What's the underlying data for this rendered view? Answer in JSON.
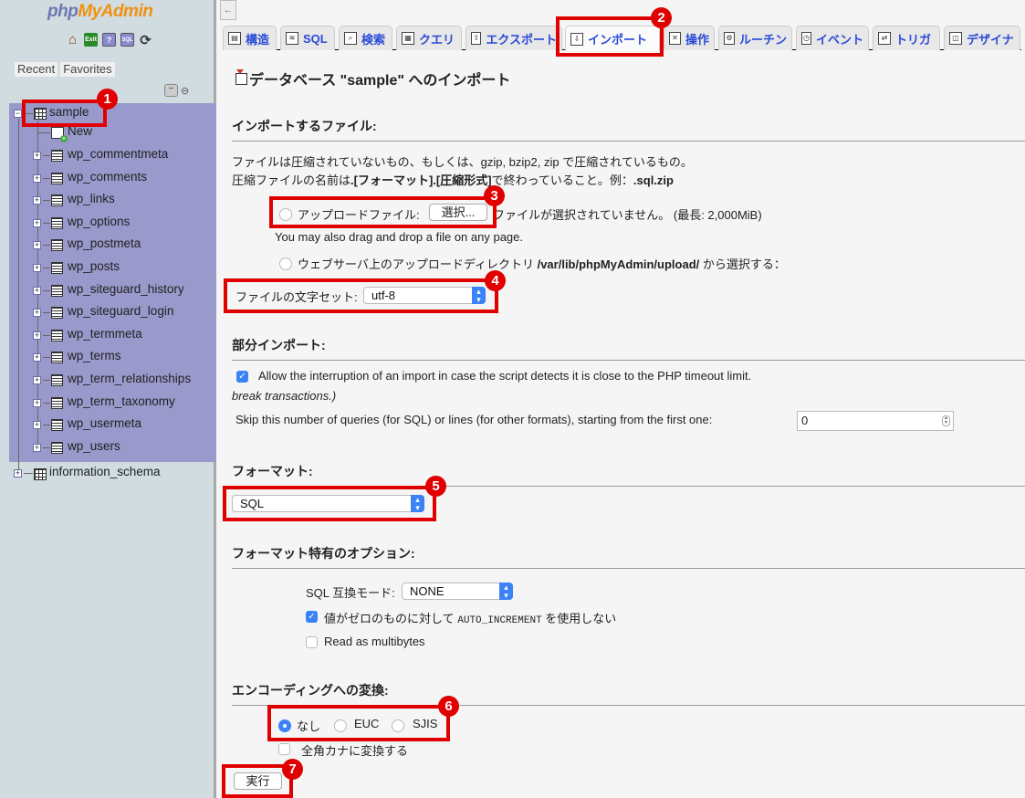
{
  "sidebar": {
    "logo": {
      "php": "php",
      "my": "My",
      "admin": "Admin"
    },
    "quick_icons": [
      "home-icon",
      "exit-icon",
      "help-icon",
      "sql-docs-icon",
      "reload-icon"
    ],
    "recent_label": "Recent",
    "favorites_label": "Favorites",
    "databases": [
      {
        "name": "sample",
        "expanded": true,
        "new_label": "New",
        "tables": [
          "wp_commentmeta",
          "wp_comments",
          "wp_links",
          "wp_options",
          "wp_postmeta",
          "wp_posts",
          "wp_siteguard_history",
          "wp_siteguard_login",
          "wp_termmeta",
          "wp_terms",
          "wp_term_relationships",
          "wp_term_taxonomy",
          "wp_usermeta",
          "wp_users"
        ]
      },
      {
        "name": "information_schema",
        "expanded": false
      }
    ],
    "highlight_color": "#9999cc"
  },
  "main": {
    "back_label": "←",
    "tabs": [
      {
        "label": "構造",
        "icon": "structure-icon"
      },
      {
        "label": "SQL",
        "icon": "sql-icon"
      },
      {
        "label": "検索",
        "icon": "search-icon"
      },
      {
        "label": "クエリ",
        "icon": "query-icon"
      },
      {
        "label": "エクスポート",
        "icon": "export-icon"
      },
      {
        "label": "インポート",
        "icon": "import-icon",
        "active": true
      },
      {
        "label": "操作",
        "icon": "operations-icon"
      },
      {
        "label": "ルーチン",
        "icon": "routines-icon"
      },
      {
        "label": "イベント",
        "icon": "events-icon"
      },
      {
        "label": "トリガ",
        "icon": "triggers-icon"
      },
      {
        "label": "デザイナ",
        "icon": "designer-icon"
      }
    ],
    "page_title": "データベース \"sample\" へのインポート",
    "file_section": {
      "heading": "インポートするファイル:",
      "desc1": "ファイルは圧縮されていないもの、もしくは、gzip, bzip2, zip で圧縮されているもの。",
      "desc2_prefix": "圧縮ファイルの名前は",
      "desc2_bold": ".[フォーマット].[圧縮形式]",
      "desc2_mid": "で終わっていること。例：",
      "desc2_example": ".sql.zip",
      "upload_label": "アップロードファイル:",
      "choose_button": "選択...",
      "no_file": "ファイルが選択されていません。",
      "max_size": "(最長: 2,000MiB)",
      "drag_drop": "You may also drag and drop a file on any page.",
      "server_dir_label": "ウェブサーバ上のアップロードディレクトリ",
      "server_dir_path": "/var/lib/phpMyAdmin/upload/",
      "server_dir_suffix": "から選択する：",
      "charset_label": "ファイルの文字セット:",
      "charset_value": "utf-8"
    },
    "partial_section": {
      "heading": "部分インポート:",
      "allow_interrupt": "Allow the interruption of an import in case the script detects it is close to the PHP timeout limit.",
      "allow_interrupt_checked": true,
      "break_note": "break transactions.)",
      "skip_label": "Skip this number of queries (for SQL) or lines (for other formats), starting from the first one:",
      "skip_value": "0"
    },
    "format_section": {
      "heading": "フォーマット:",
      "format_value": "SQL"
    },
    "format_options": {
      "heading": "フォーマット特有のオプション:",
      "compat_label": "SQL 互換モード:",
      "compat_value": "NONE",
      "no_auto_value_prefix": "値がゼロのものに対して",
      "no_auto_value_code": "AUTO_INCREMENT",
      "no_auto_value_suffix": "を使用しない",
      "no_auto_value_checked": true,
      "multibytes_label": "Read as multibytes",
      "multibytes_checked": false
    },
    "encoding_section": {
      "heading": "エンコーディングへの変換:",
      "options": [
        "なし",
        "EUC",
        "SJIS"
      ],
      "selected": "なし",
      "kana_label": "全角カナに変換する",
      "kana_checked": false
    },
    "submit_label": "実行"
  },
  "annotations": {
    "color": "#e00000",
    "numbers": [
      "1",
      "2",
      "3",
      "4",
      "5",
      "6",
      "7"
    ]
  }
}
